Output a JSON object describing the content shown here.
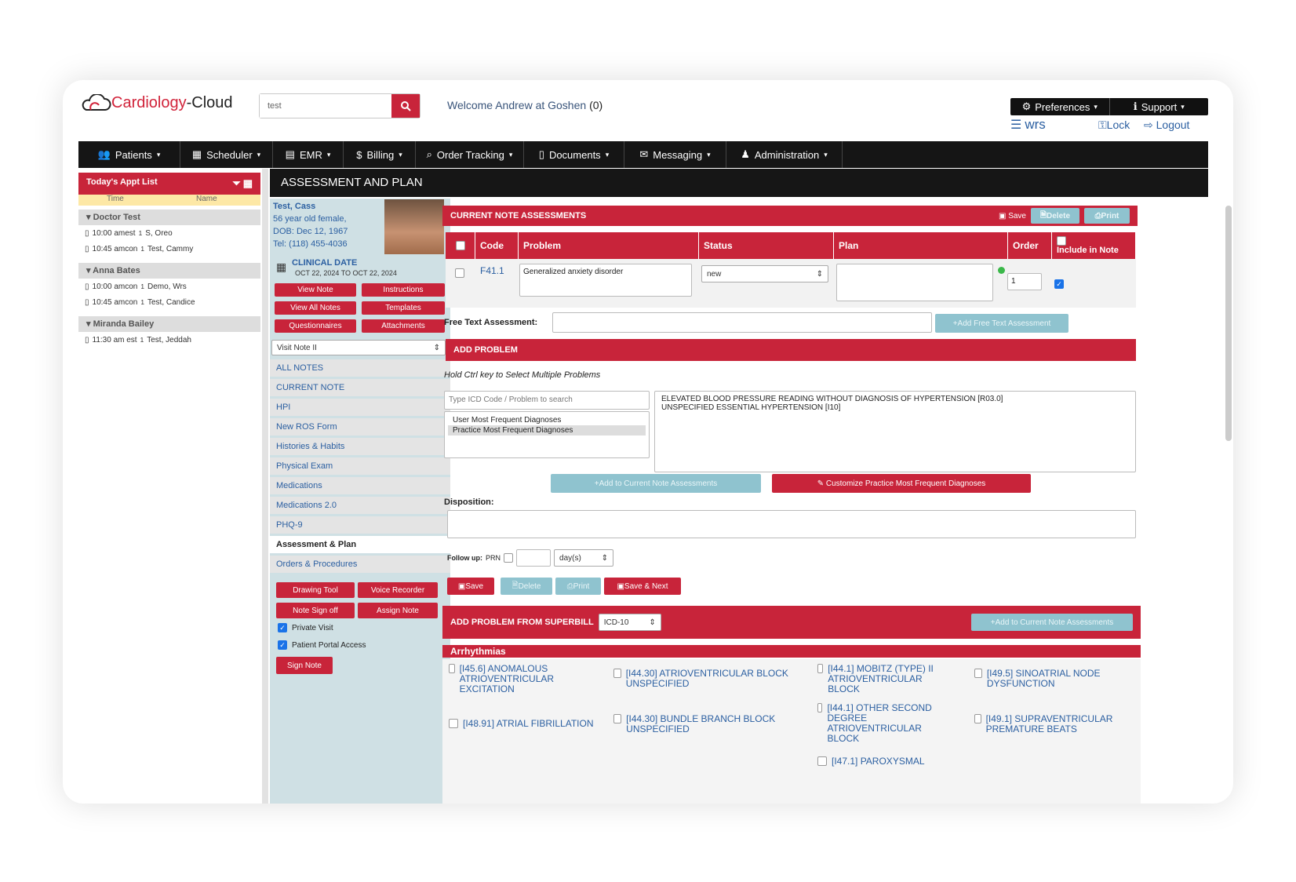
{
  "header": {
    "logo_main": "Cardiology",
    "logo_sub": "-Cloud",
    "search_value": "test",
    "welcome_text": "Welcome Andrew at Goshen",
    "welcome_count": "(0)",
    "preferences": "Preferences",
    "support": "Support",
    "wrs": "wrs",
    "lock": "Lock",
    "logout": "Logout"
  },
  "nav": [
    "Patients",
    "Scheduler",
    "EMR",
    "Billing",
    "Order Tracking",
    "Documents",
    "Messaging",
    "Administration"
  ],
  "appt": {
    "title": "Today's Appt List",
    "col_time": "Time",
    "col_name": "Name",
    "groups": [
      {
        "name": "Doctor Test",
        "rows": [
          {
            "time": "10:00 amest",
            "sup": "1",
            "patient": "S, Oreo"
          },
          {
            "time": "10:45 amcon",
            "sup": "1",
            "patient": "Test, Cammy"
          }
        ]
      },
      {
        "name": "Anna Bates",
        "rows": [
          {
            "time": "10:00 amcon",
            "sup": "1",
            "patient": "Demo, Wrs"
          },
          {
            "time": "10:45 amcon",
            "sup": "1",
            "patient": "Test, Candice"
          }
        ]
      },
      {
        "name": "Miranda Bailey",
        "rows": [
          {
            "time": "11:30 am est",
            "sup": "1",
            "patient": "Test, Jeddah"
          }
        ]
      }
    ]
  },
  "page_title": "ASSESSMENT AND PLAN",
  "patient": {
    "name": "Test, Cass",
    "line1": "56 year old female,",
    "dob": "DOB: Dec 12, 1967",
    "tel": "Tel: (118) 455-4036",
    "clinical_label": "CLINICAL DATE",
    "clinical_range": "OCT 22, 2024 TO OCT 22, 2024"
  },
  "note_buttons": [
    "View Note",
    "Instructions",
    "View All Notes",
    "Templates",
    "Questionnaires",
    "Attachments"
  ],
  "visit_note": "Visit Note II",
  "note_nav": [
    "ALL NOTES",
    "CURRENT NOTE",
    "HPI",
    "New ROS Form",
    "Histories & Habits",
    "Physical Exam",
    "Medications",
    "Medications 2.0",
    "PHQ-9",
    "Assessment & Plan",
    "Orders & Procedures"
  ],
  "tools": {
    "drawing": "Drawing Tool",
    "voice": "Voice Recorder",
    "signoff": "Note Sign off",
    "assign": "Assign Note",
    "private": "Private Visit",
    "portal": "Patient Portal Access",
    "sign": "Sign Note"
  },
  "assess": {
    "title": "CURRENT NOTE ASSESSMENTS",
    "save": "Save",
    "delete": "Delete",
    "print": "Print",
    "cols": {
      "code": "Code",
      "problem": "Problem",
      "status": "Status",
      "plan": "Plan",
      "order": "Order",
      "include": "Include in Note"
    },
    "row": {
      "code": "F41.1",
      "problem": "Generalized anxiety disorder",
      "status": "new",
      "order": "1"
    },
    "free_text_label": "Free Text Assessment:",
    "add_free": "Add Free Text Assessment"
  },
  "add_problem": {
    "title": "ADD PROBLEM",
    "hint": "Hold Ctrl key to Select Multiple Problems",
    "search_placeholder": "Type ICD Code / Problem to search",
    "lists": [
      "User Most Frequent Diagnoses",
      "Practice Most Frequent Diagnoses"
    ],
    "results": [
      "ELEVATED BLOOD PRESSURE READING WITHOUT DIAGNOSIS OF HYPERTENSION [R03.0]",
      "UNSPECIFIED ESSENTIAL HYPERTENSION [I10]"
    ],
    "add_btn": "Add to Current Note Assessments",
    "customize_btn": "Customize Practice Most Frequent Diagnoses",
    "disposition": "Disposition:",
    "followup": "Follow up:",
    "prn": "PRN",
    "unit": "day(s)",
    "save": "Save",
    "delete": "Delete",
    "print": "Print",
    "save_next": "Save & Next"
  },
  "superbill": {
    "title": "ADD PROBLEM FROM SUPERBILL",
    "code_set": "ICD-10",
    "add_btn": "Add to Current Note Assessments",
    "section": "Arrhythmias",
    "items": [
      "[I45.6] ANOMALOUS ATRIOVENTRICULAR EXCITATION",
      "[I44.30] ATRIOVENTRICULAR BLOCK UNSPECIFIED",
      "[I44.1] MOBITZ (TYPE) II ATRIOVENTRICULAR BLOCK",
      "[I49.5] SINOATRIAL NODE DYSFUNCTION",
      "[I48.91] ATRIAL FIBRILLATION",
      "[I44.30] BUNDLE BRANCH BLOCK UNSPECIFIED",
      "[I44.1] OTHER SECOND DEGREE ATRIOVENTRICULAR BLOCK",
      "[I49.1] SUPRAVENTRICULAR PREMATURE BEATS",
      "[I47.1] PAROXYSMAL"
    ]
  }
}
